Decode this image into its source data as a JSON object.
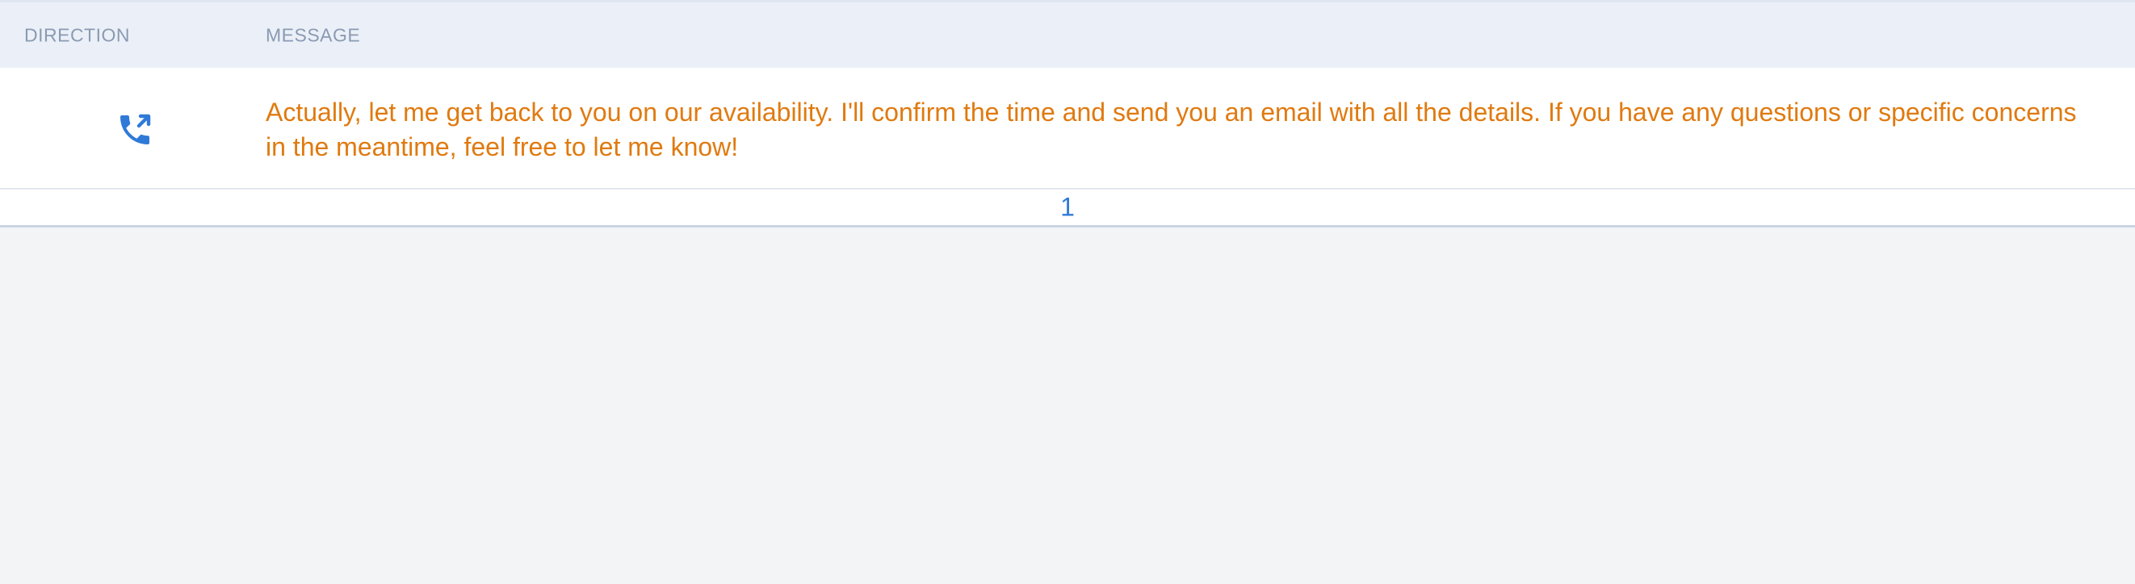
{
  "table": {
    "columns": {
      "direction": "DIRECTION",
      "message": "MESSAGE"
    },
    "rows": [
      {
        "direction_icon": "outgoing-call-icon",
        "message": "Actually, let me get back to you on our availability. I'll confirm the time and send you an email with all the details. If you have any questions or specific concerns in the meantime, feel free to let me know!"
      }
    ]
  },
  "pagination": {
    "current_page": "1"
  },
  "colors": {
    "message_text": "#e07a10",
    "icon": "#2f7ad8",
    "header_bg": "#ebf0f8",
    "header_text": "#8a9ab2",
    "page_link": "#2f7ad8"
  }
}
